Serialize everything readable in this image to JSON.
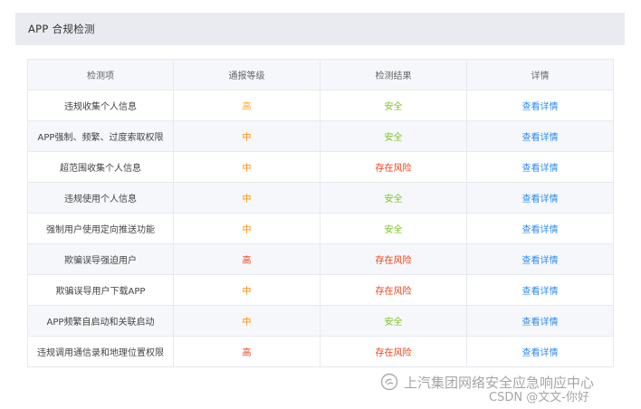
{
  "header": {
    "title": "APP 合规检测"
  },
  "table": {
    "columns": [
      "检测项",
      "通报等级",
      "检测结果",
      "详情"
    ],
    "colors": {
      "level_high": "#ff8a00",
      "level_medium": "#ff8a00",
      "level_high_alt": "#ed4014",
      "result_safe": "#52c41a",
      "result_risk": "#ed4014",
      "link": "#2d8cf0"
    },
    "rows": [
      {
        "item": "违规收集个人信息",
        "level": "高",
        "level_color": "#f5a623",
        "result": "安全",
        "result_color": "#7cc521",
        "detail": "查看详情"
      },
      {
        "item": "APP强制、频繁、过度索取权限",
        "level": "中",
        "level_color": "#ff8a00",
        "result": "安全",
        "result_color": "#7cc521",
        "detail": "查看详情"
      },
      {
        "item": "超范围收集个人信息",
        "level": "中",
        "level_color": "#ff8a00",
        "result": "存在风险",
        "result_color": "#ed4014",
        "detail": "查看详情"
      },
      {
        "item": "违规使用个人信息",
        "level": "中",
        "level_color": "#ff8a00",
        "result": "安全",
        "result_color": "#7cc521",
        "detail": "查看详情"
      },
      {
        "item": "强制用户使用定向推送功能",
        "level": "中",
        "level_color": "#ff8a00",
        "result": "安全",
        "result_color": "#7cc521",
        "detail": "查看详情"
      },
      {
        "item": "欺骗误导强迫用户",
        "level": "高",
        "level_color": "#ed4014",
        "result": "存在风险",
        "result_color": "#ed4014",
        "detail": "查看详情"
      },
      {
        "item": "欺骗误导用户下载APP",
        "level": "中",
        "level_color": "#ff8a00",
        "result": "存在风险",
        "result_color": "#ed4014",
        "detail": "查看详情"
      },
      {
        "item": "APP频繁自启动和关联启动",
        "level": "中",
        "level_color": "#ff8a00",
        "result": "安全",
        "result_color": "#7cc521",
        "detail": "查看详情"
      },
      {
        "item": "违规调用通信录和地理位置权限",
        "level": "高",
        "level_color": "#ed4014",
        "result": "存在风险",
        "result_color": "#ed4014",
        "detail": "查看详情"
      }
    ]
  },
  "watermark": {
    "account": "上汽集团网络安全应急响应中心",
    "credit": "CSDN @文文-你好",
    "icon": "wechat-official-account-icon"
  }
}
